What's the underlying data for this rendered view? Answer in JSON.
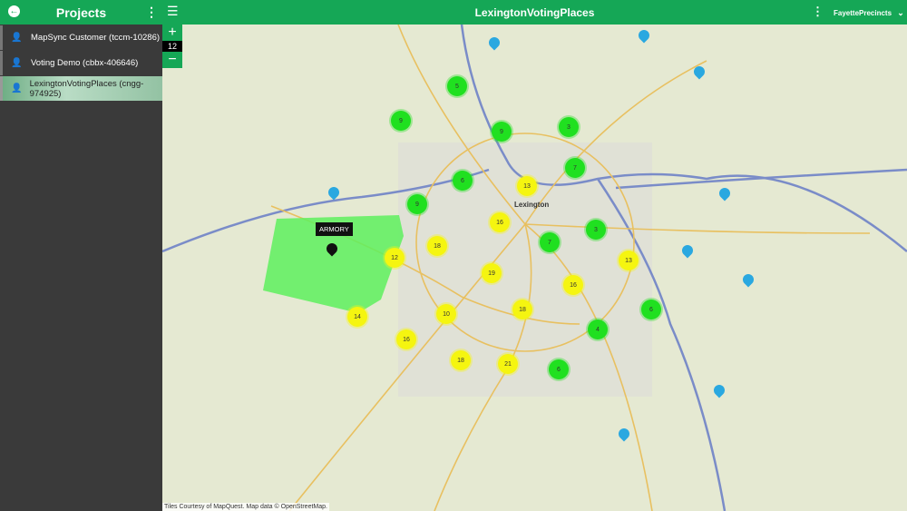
{
  "sidebar": {
    "title": "Projects",
    "items": [
      {
        "label": "MapSync Customer (tccm-10286)",
        "active": false
      },
      {
        "label": "Voting Demo (cbbx-406646)",
        "active": false
      },
      {
        "label": "LexingtonVotingPlaces (cngg-974925)",
        "active": true
      }
    ]
  },
  "header": {
    "title": "LexingtonVotingPlaces",
    "layer_select": "FayettePrecincts"
  },
  "map": {
    "zoom_level": "12",
    "zoom_in": "+",
    "zoom_out": "−",
    "city_label": "Lexington",
    "selected_marker": "ARMORY",
    "attribution": "Tiles Courtesy of MapQuest. Map data © OpenStreetMap.",
    "clusters": [
      5,
      9,
      9,
      3,
      7,
      6,
      9,
      3,
      7,
      6,
      4,
      6,
      13,
      16,
      18,
      12,
      19,
      13,
      16,
      18,
      10,
      14,
      16,
      18,
      21
    ],
    "colors": {
      "accent": "#15a756",
      "cluster_small": "#20e020",
      "cluster_large": "#f5f510",
      "pin": "#2aa8e0",
      "selected_area": "#5ef05e"
    }
  }
}
